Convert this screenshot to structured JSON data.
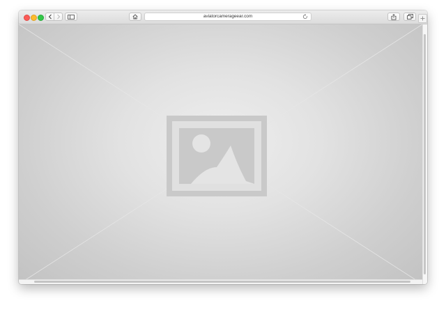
{
  "browser": {
    "address_bar": {
      "url": "aviatorcamerageear.com"
    },
    "icons": {
      "back": "chevron-left-icon",
      "forward": "chevron-right-icon",
      "sidebar": "sidebar-icon",
      "home": "home-icon",
      "reload": "reload-icon",
      "share": "share-icon",
      "tabs": "tabs-icon",
      "new_tab": "plus-icon"
    },
    "traffic_lights": {
      "close": "#fc5b57",
      "minimize": "#fdbb2e",
      "maximize": "#33c748"
    }
  },
  "page": {
    "placeholder_image": "image-placeholder-icon"
  }
}
